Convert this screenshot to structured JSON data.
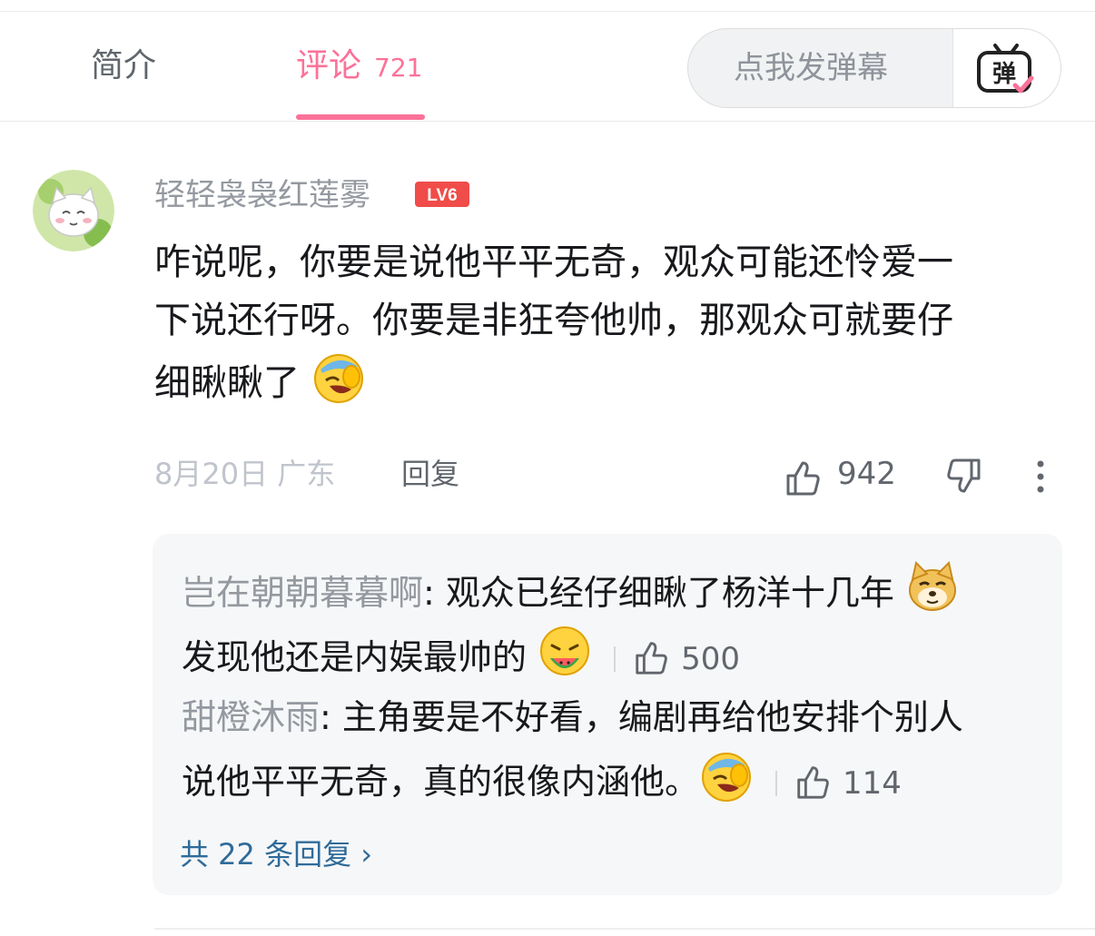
{
  "tabs": {
    "intro_label": "简介",
    "comments_label": "评论",
    "comments_count": "721"
  },
  "danmaku": {
    "placeholder": "点我发弹幕",
    "button_glyph": "弹"
  },
  "comment": {
    "username": "轻轻袅袅红莲雾",
    "level": "LV6",
    "text_line1": "咋说呢，你要是说他平平无奇，观众可能还怜爱一",
    "text_line2": "下说还行呀。你要是非狂夸他帅，那观众可就要仔",
    "text_line3": "细瞅瞅了",
    "date": "8月20日",
    "location": "广东",
    "reply_label": "回复",
    "like_count": "942"
  },
  "replies": [
    {
      "author": "岂在朝朝暮暮啊",
      "text_line1": ": 观众已经仔细瞅了杨洋十几年",
      "text_line2": "发现他还是内娱最帅的",
      "like_count": "500"
    },
    {
      "author": "甜橙沐雨",
      "text_line1": ": 主角要是不好看，编剧再给他安排个别人",
      "text_line2": "说他平平无奇，真的很像内涵他。",
      "like_count": "114"
    }
  ],
  "total_replies_label": "共 22 条回复 ›",
  "colors": {
    "accent": "#fb7299",
    "link": "#2f6b9a",
    "muted": "#9499a0",
    "level_badge": "#f04c49"
  },
  "icons": [
    "danmaku-icon",
    "like-icon",
    "dislike-icon",
    "more-icon",
    "facepalm-emoji",
    "doge-emoji",
    "watermelon-emoji"
  ]
}
